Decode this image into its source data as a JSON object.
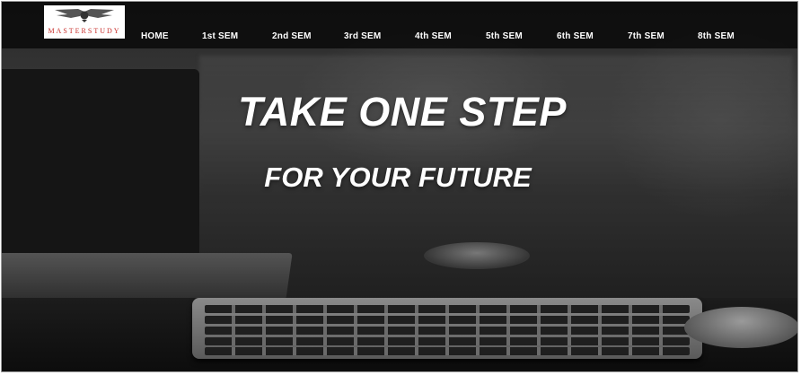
{
  "header": {
    "logo_text": "MASTERSTUDY",
    "nav_items": [
      {
        "label": "HOME"
      },
      {
        "label": "1st SEM"
      },
      {
        "label": "2nd SEM"
      },
      {
        "label": "3rd SEM"
      },
      {
        "label": "4th SEM"
      },
      {
        "label": "5th SEM"
      },
      {
        "label": "6th SEM"
      },
      {
        "label": "7th SEM"
      },
      {
        "label": "8th SEM"
      }
    ]
  },
  "hero": {
    "headline": "TAKE ONE STEP",
    "subheadline": "FOR YOUR FUTURE"
  },
  "colors": {
    "navbar_bg": "#080808",
    "nav_text": "#ffffff",
    "brand_accent": "#c9302c"
  }
}
